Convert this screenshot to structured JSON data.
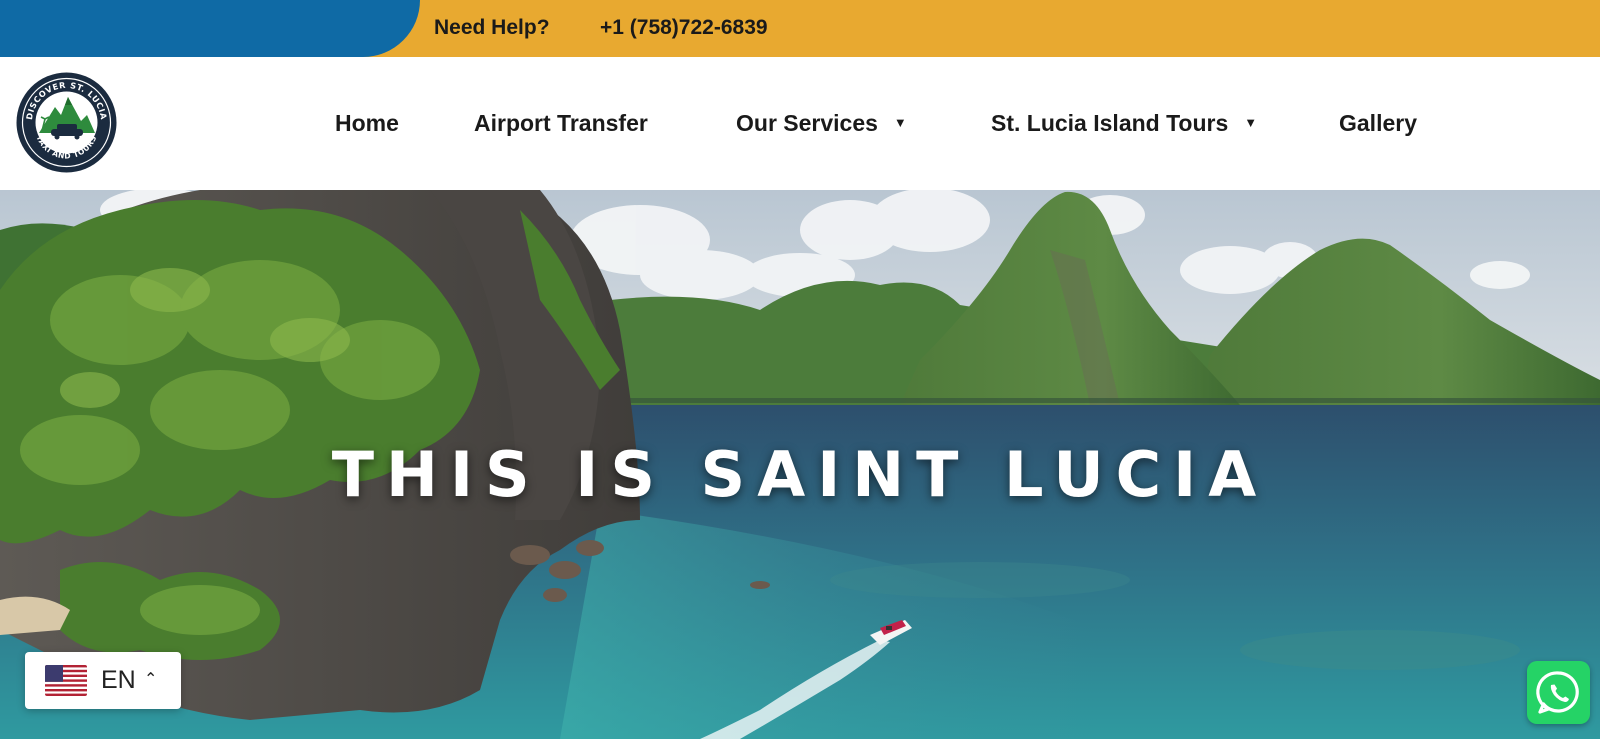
{
  "topbar": {
    "help_label": "Need Help?",
    "phone": "+1 (758)722-6839",
    "colors": {
      "gold": "#e8a930",
      "blue": "#0f6aa5"
    }
  },
  "logo": {
    "ring_text": "DISCOVER ST. LUCIA TAXI AND TOURS",
    "icon": "mountain-car-logo"
  },
  "nav": {
    "items": [
      {
        "label": "Home"
      },
      {
        "label": "Airport Transfer"
      },
      {
        "label": "Our Services",
        "has_dropdown": true
      },
      {
        "label": "St. Lucia Island Tours",
        "has_dropdown": true
      },
      {
        "label": "Gallery"
      }
    ],
    "dropdown_icon": "caret-down-icon"
  },
  "hero": {
    "title": "THIS IS SAINT LUCIA"
  },
  "language": {
    "code": "EN",
    "flag_icon": "us-flag-icon",
    "caret_icon": "caret-up-icon"
  },
  "whatsapp": {
    "icon": "whatsapp-icon",
    "color": "#25d366"
  }
}
